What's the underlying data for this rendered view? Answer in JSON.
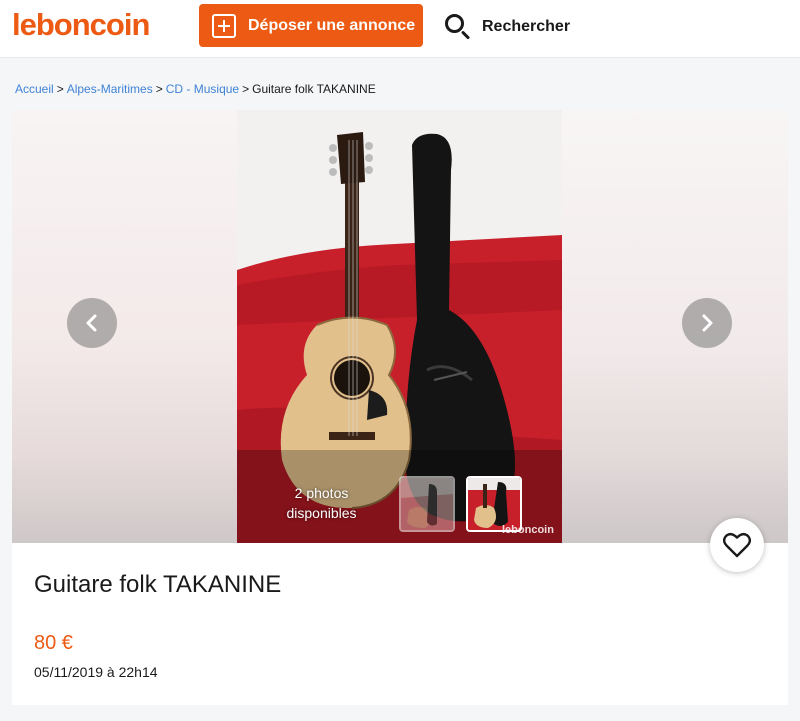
{
  "header": {
    "logo": "leboncoin",
    "deposit_label": "Déposer une annonce",
    "search_label": "Rechercher"
  },
  "breadcrumb": {
    "items": [
      "Accueil",
      "Alpes-Maritimes",
      "CD - Musique"
    ],
    "current": "Guitare folk TAKANINE",
    "separator": ">"
  },
  "gallery": {
    "photos_count_line1": "2 photos",
    "photos_count_line2": "disponibles",
    "watermark": "leboncoin"
  },
  "ad": {
    "title": "Guitare folk TAKANINE",
    "price": "80 €",
    "date": "05/11/2019 à 22h14"
  },
  "colors": {
    "brand": "#ec5a13",
    "link": "#4183d7"
  },
  "icons": [
    "plus-square-icon",
    "search-icon",
    "chevron-left-icon",
    "chevron-right-icon",
    "heart-icon"
  ]
}
